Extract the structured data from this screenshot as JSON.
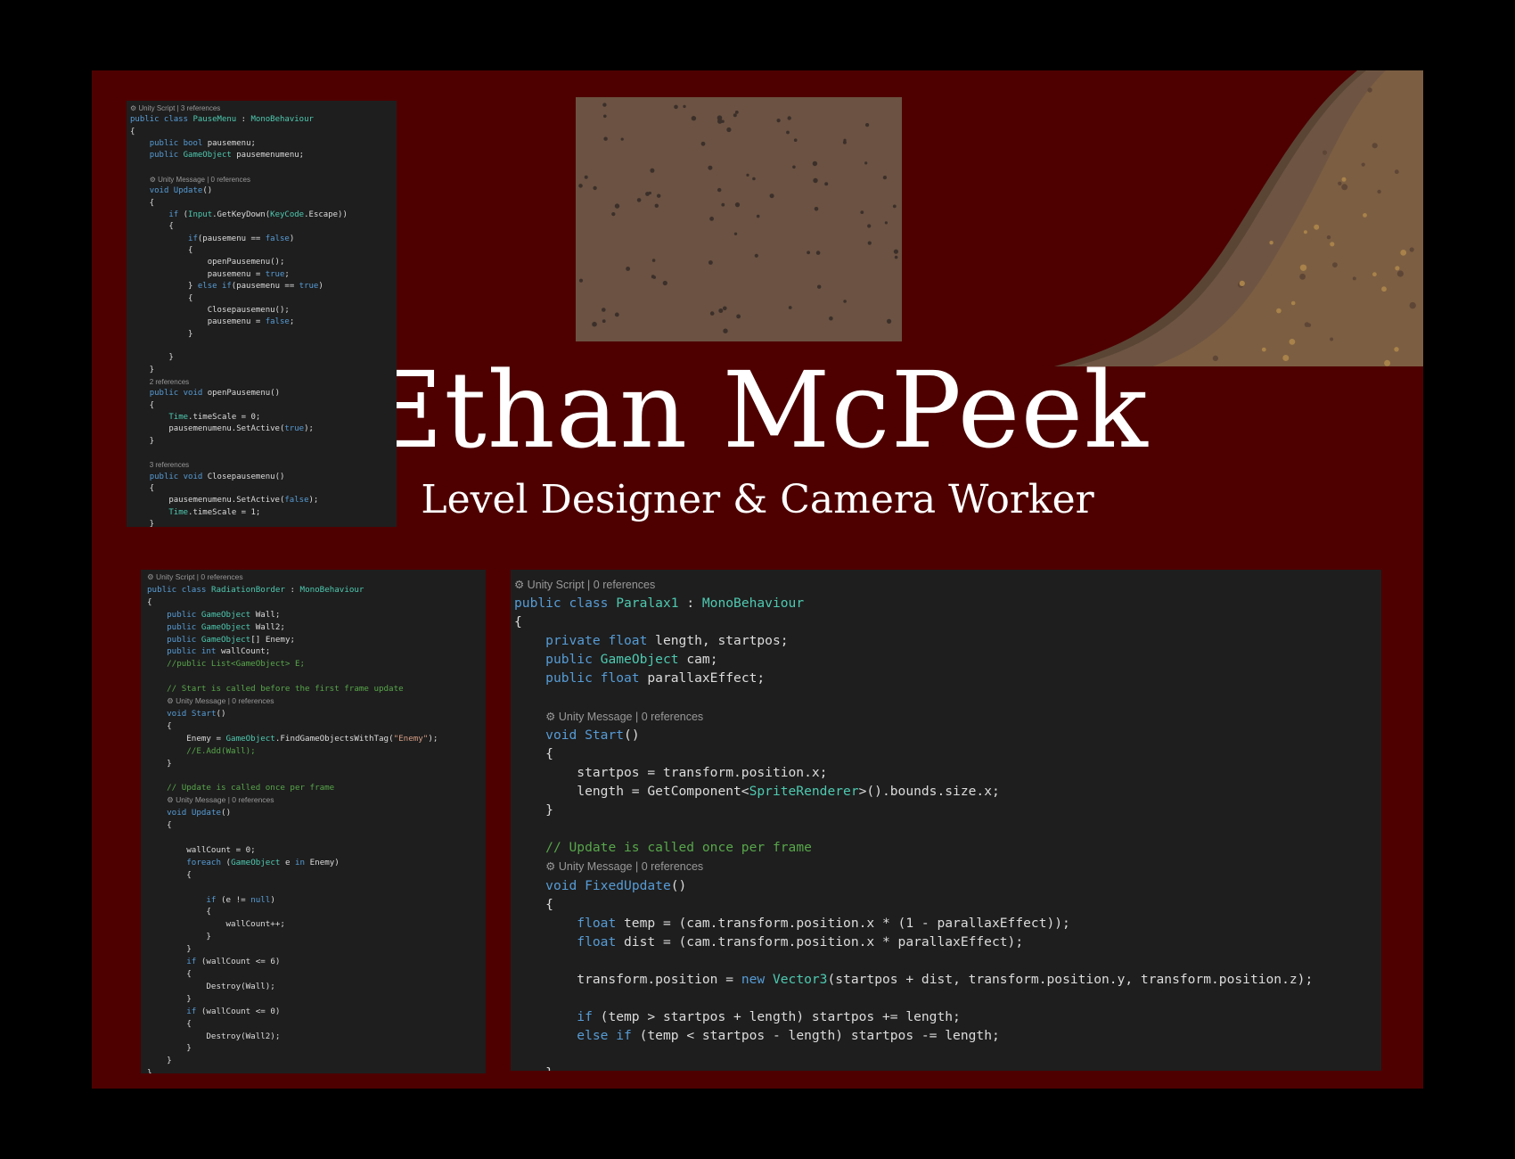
{
  "header": {
    "name": "Ethan McPeek",
    "role": "Level Designer & Camera Worker"
  },
  "colors": {
    "poster_bg": "#4e0000",
    "page_bg": "#000000",
    "editor_bg": "#1e1e1e",
    "keyword": "#569cd6",
    "type": "#4ec9b0",
    "comment": "#57a64a",
    "string": "#d69d85"
  },
  "panels": {
    "pause_menu": {
      "lines": [
        "<span class='lens'>⚙ Unity Script | 3 references</span>",
        "<span class='k'>public class</span> <span class='t'>PauseMenu</span> : <span class='t'>MonoBehaviour</span>",
        "{",
        "    <span class='k'>public bool</span> pausemenu;",
        "    <span class='k'>public</span> <span class='t'>GameObject</span> pausemenumenu;",
        "",
        "    <span class='lens'>⚙ Unity Message | 0 references</span>",
        "    <span class='k'>void</span> <span class='k'>Update</span>()",
        "    {",
        "        <span class='k'>if</span> (<span class='t'>Input</span>.GetKeyDown(<span class='t'>KeyCode</span>.Escape))",
        "        {",
        "            <span class='k'>if</span>(pausemenu == <span class='k'>false</span>)",
        "            {",
        "                openPausemenu();",
        "                pausemenu = <span class='k'>true</span>;",
        "            } <span class='k'>else if</span>(pausemenu == <span class='k'>true</span>)",
        "            {",
        "                Closepausemenu();",
        "                pausemenu = <span class='k'>false</span>;",
        "            }",
        "",
        "        }",
        "    }",
        "    <span class='lens'>2 references</span>",
        "    <span class='k'>public void</span> openPausemenu()",
        "    {",
        "        <span class='t'>Time</span>.timeScale = 0;",
        "        pausemenumenu.SetActive(<span class='k'>true</span>);",
        "    }",
        "",
        "    <span class='lens'>3 references</span>",
        "    <span class='k'>public void</span> Closepausemenu()",
        "    {",
        "        pausemenumenu.SetActive(<span class='k'>false</span>);",
        "        <span class='t'>Time</span>.timeScale = 1;",
        "    }",
        "}"
      ]
    },
    "radiation_border": {
      "lines": [
        "<span class='lens'>⚙ Unity Script | 0 references</span>",
        "<span class='k'>public class</span> <span class='t'>RadiationBorder</span> : <span class='t'>MonoBehaviour</span>",
        "{",
        "    <span class='k'>public</span> <span class='t'>GameObject</span> Wall;",
        "    <span class='k'>public</span> <span class='t'>GameObject</span> Wall2;",
        "    <span class='k'>public</span> <span class='t'>GameObject</span>[] Enemy;",
        "    <span class='k'>public int</span> wallCount;",
        "    <span class='c'>//public List&lt;GameObject&gt; E;</span>",
        "",
        "    <span class='c'>// Start is called before the first frame update</span>",
        "    <span class='lens'>⚙ Unity Message | 0 references</span>",
        "    <span class='k'>void</span> <span class='k'>Start</span>()",
        "    {",
        "        Enemy = <span class='t'>GameObject</span>.FindGameObjectsWithTag(<span class='s'>\"Enemy\"</span>);",
        "        <span class='c'>//E.Add(Wall);</span>",
        "    }",
        "",
        "    <span class='c'>// Update is called once per frame</span>",
        "    <span class='lens'>⚙ Unity Message | 0 references</span>",
        "    <span class='k'>void</span> <span class='k'>Update</span>()",
        "    {",
        "",
        "        wallCount = 0;",
        "        <span class='k'>foreach</span> (<span class='t'>GameObject</span> e <span class='k'>in</span> Enemy)",
        "        {",
        "",
        "            <span class='k'>if</span> (e != <span class='k'>null</span>)",
        "            {",
        "                wallCount++;",
        "            }",
        "        }",
        "        <span class='k'>if</span> (wallCount &lt;= 6)",
        "        {",
        "            Destroy(Wall);",
        "        }",
        "        <span class='k'>if</span> (wallCount &lt;= 0)",
        "        {",
        "            Destroy(Wall2);",
        "        }",
        "    }",
        "}"
      ]
    },
    "paralax": {
      "lines": [
        "<span class='lens'>⚙ Unity Script | 0 references</span>",
        "<span class='k'>public class</span> <span class='t'>Paralax1</span> : <span class='t'>MonoBehaviour</span>",
        "{",
        "    <span class='k'>private float</span> length, startpos;",
        "    <span class='k'>public</span> <span class='t'>GameObject</span> cam;",
        "    <span class='k'>public float</span> parallaxEffect;",
        "",
        "    <span class='lens'>⚙ Unity Message | 0 references</span>",
        "    <span class='k'>void</span> <span class='k'>Start</span>()",
        "    {",
        "        startpos = transform.position.x;",
        "        length = GetComponent&lt;<span class='t'>SpriteRenderer</span>&gt;().bounds.size.x;",
        "    }",
        "",
        "    <span class='c'>// Update is called once per frame</span>",
        "    <span class='lens'>⚙ Unity Message | 0 references</span>",
        "    <span class='k'>void</span> <span class='k'>FixedUpdate</span>()",
        "    {",
        "        <span class='k'>float</span> temp = (cam.transform.position.x * (1 - parallaxEffect));",
        "        <span class='k'>float</span> dist = (cam.transform.position.x * parallaxEffect);",
        "",
        "        transform.position = <span class='k'>new</span> <span class='t'>Vector3</span>(startpos + dist, transform.position.y, transform.position.z);",
        "",
        "        <span class='k'>if</span> (temp &gt; startpos + length) startpos += length;",
        "        <span class='k'>else if</span> (temp &lt; startpos - length) startpos -= length;",
        "",
        "    }"
      ]
    }
  }
}
